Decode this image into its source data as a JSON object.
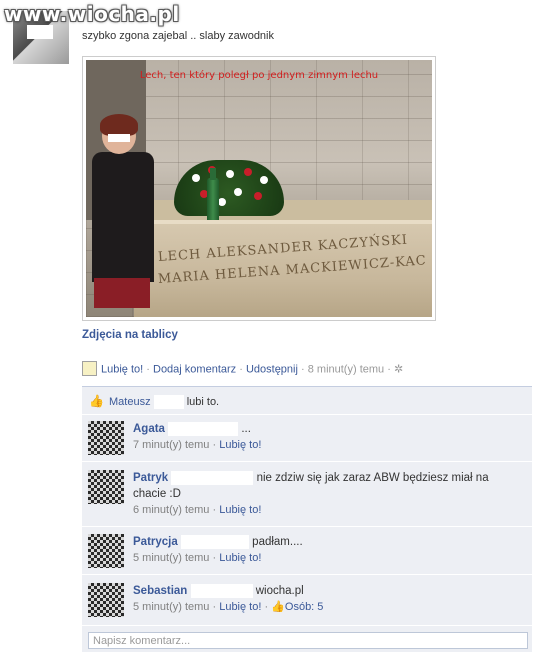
{
  "watermark": "www.wiocha.pl",
  "post": {
    "text": "szybko zgona zajebal .. slaby zawodnik",
    "photo_caption": "Lech, ten który poległ po jednym zimnym lechu",
    "engraving_line1": "LECH ALEKSANDER KACZYŃSKI",
    "engraving_line2": "MARIA HELENA MACKIEWICZ-KAC",
    "album_link": "Zdjęcia na tablicy"
  },
  "actions": {
    "like": "Lubię to!",
    "comment": "Dodaj komentarz",
    "share": "Udostępnij",
    "time": "8 minut(y) temu"
  },
  "likes": {
    "name": "Mateusz",
    "suffix": "lubi to."
  },
  "comments": [
    {
      "name": "Agata",
      "text": "...",
      "time": "7 minut(y) temu",
      "like": "Lubię to!",
      "extra": ""
    },
    {
      "name": "Patryk",
      "text": "nie zdziw się jak zaraz ABW będziesz miał na",
      "text2": "chacie :D",
      "time": "6 minut(y) temu",
      "like": "Lubię to!",
      "extra": ""
    },
    {
      "name": "Patrycja",
      "text": "padłam....",
      "time": "5 minut(y) temu",
      "like": "Lubię to!",
      "extra": ""
    },
    {
      "name": "Sebastian",
      "text": "wiocha.pl",
      "time": "5 minut(y) temu",
      "like": "Lubię to!",
      "extra": "Osób: 5"
    }
  ],
  "comment_input": {
    "placeholder": "Napisz komentarz..."
  },
  "colors": {
    "link": "#3b5998",
    "feedback_bg": "#edeff4",
    "caption_red": "#d21e1e"
  }
}
